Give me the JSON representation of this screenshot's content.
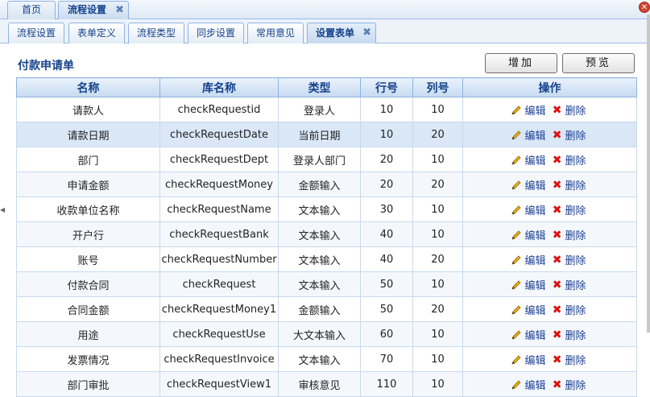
{
  "top_tabs": [
    {
      "label": "首页"
    },
    {
      "label": "流程设置"
    }
  ],
  "sub_tabs": [
    {
      "label": "流程设置"
    },
    {
      "label": "表单定义"
    },
    {
      "label": "流程类型"
    },
    {
      "label": "同步设置"
    },
    {
      "label": "常用意见"
    },
    {
      "label": "设置表单"
    }
  ],
  "panel": {
    "title": "付款申请单",
    "add_label": "增加",
    "preview_label": "预览"
  },
  "table": {
    "headers": [
      "名称",
      "库名称",
      "类型",
      "行号",
      "列号",
      "操作"
    ],
    "edit_label": "编辑",
    "delete_label": "删除",
    "rows": [
      {
        "name": "请款人",
        "db": "checkRequestid",
        "type": "登录人",
        "row": "10",
        "col": "10"
      },
      {
        "name": "请款日期",
        "db": "checkRequestDate",
        "type": "当前日期",
        "row": "10",
        "col": "20"
      },
      {
        "name": "部门",
        "db": "checkRequestDept",
        "type": "登录人部门",
        "row": "20",
        "col": "10"
      },
      {
        "name": "申请金额",
        "db": "checkRequestMoney",
        "type": "金额输入",
        "row": "20",
        "col": "20"
      },
      {
        "name": "收款单位名称",
        "db": "checkRequestName",
        "type": "文本输入",
        "row": "30",
        "col": "10"
      },
      {
        "name": "开户行",
        "db": "checkRequestBank",
        "type": "文本输入",
        "row": "40",
        "col": "10"
      },
      {
        "name": "账号",
        "db": "checkRequestNumber",
        "type": "文本输入",
        "row": "40",
        "col": "20"
      },
      {
        "name": "付款合同",
        "db": "checkRequest",
        "type": "文本输入",
        "row": "50",
        "col": "10"
      },
      {
        "name": "合同金额",
        "db": "checkRequestMoney1",
        "type": "金额输入",
        "row": "50",
        "col": "20"
      },
      {
        "name": "用途",
        "db": "checkRequestUse",
        "type": "大文本输入",
        "row": "60",
        "col": "10"
      },
      {
        "name": "发票情况",
        "db": "checkRequestInvoice",
        "type": "文本输入",
        "row": "70",
        "col": "10"
      },
      {
        "name": "部门审批",
        "db": "checkRequestView1",
        "type": "审核意见",
        "row": "110",
        "col": "10"
      }
    ]
  },
  "icons": {
    "edit": "pencil-icon",
    "delete": "red-x-icon",
    "tab_close": "close-icon"
  },
  "colors": {
    "accent": "#15428b",
    "header_bg": "#c6daf1",
    "selected_row": "#d9e7f7",
    "delete_red": "#dd1111"
  }
}
